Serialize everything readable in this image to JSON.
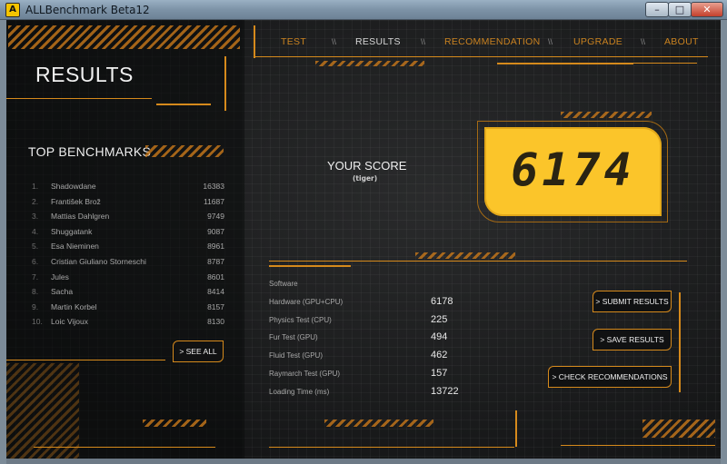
{
  "window": {
    "title": "ALLBenchmark Beta12",
    "icon": "app-logo-icon",
    "controls": {
      "minimize": "–",
      "maximize": "□",
      "close": "✕"
    }
  },
  "nav": {
    "items": [
      {
        "label": "TEST",
        "active": false
      },
      {
        "label": "RESULTS",
        "active": true
      },
      {
        "label": "RECOMMENDATION",
        "active": false
      },
      {
        "label": "UPGRADE",
        "active": false
      },
      {
        "label": "ABOUT",
        "active": false
      }
    ],
    "separator": "\\\\"
  },
  "sidebar": {
    "heading": "RESULTS",
    "top_heading": "TOP BENCHMARKS",
    "benchmarks": [
      {
        "rank": "1.",
        "name": "Shadowdane",
        "score": "16383"
      },
      {
        "rank": "2.",
        "name": "František Brož",
        "score": "11687"
      },
      {
        "rank": "3.",
        "name": "Mattias Dahlgren",
        "score": "9749"
      },
      {
        "rank": "4.",
        "name": "Shuggatank",
        "score": "9087"
      },
      {
        "rank": "5.",
        "name": "Esa Nieminen",
        "score": "8961"
      },
      {
        "rank": "6.",
        "name": "Cristian Giuliano Storneschi",
        "score": "8787"
      },
      {
        "rank": "7.",
        "name": "Jules",
        "score": "8601"
      },
      {
        "rank": "8.",
        "name": "Sacha",
        "score": "8414"
      },
      {
        "rank": "9.",
        "name": "Martin Korbel",
        "score": "8157"
      },
      {
        "rank": "10.",
        "name": "Loic Vijoux",
        "score": "8130"
      }
    ],
    "see_all": "> SEE ALL"
  },
  "score": {
    "label": "YOUR SCORE",
    "profile": "(tiger)",
    "value": "6174"
  },
  "results": [
    {
      "label": "Software",
      "value": ""
    },
    {
      "label": "Hardware (GPU+CPU)",
      "value": "6178"
    },
    {
      "label": "Physics Test (CPU)",
      "value": "225"
    },
    {
      "label": "Fur Test (GPU)",
      "value": "494"
    },
    {
      "label": "Fluid Test (GPU)",
      "value": "462"
    },
    {
      "label": "Raymarch Test (GPU)",
      "value": "157"
    },
    {
      "label": "Loading Time (ms)",
      "value": "13722"
    }
  ],
  "actions": {
    "submit": "> SUBMIT RESULTS",
    "save": "> SAVE RESULTS",
    "check": "> CHECK RECOMMENDATIONS"
  },
  "colors": {
    "accent": "#d68a1c",
    "score_bg": "#fbc52a",
    "nav_inactive": "#c98220",
    "nav_active": "#d8d8d8"
  }
}
